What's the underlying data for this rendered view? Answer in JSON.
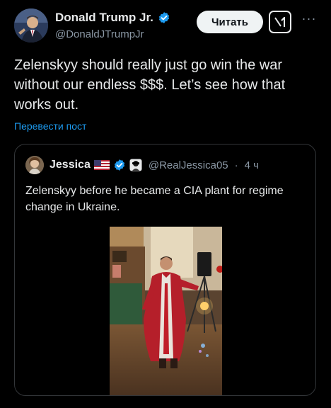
{
  "author": {
    "display_name": "Donald Trump Jr.",
    "handle": "@DonaldJTrumpJr",
    "follow_label": "Читать",
    "grok_icon": "grok-icon",
    "more_icon": "more-dots-icon",
    "more_label": "···"
  },
  "tweet": {
    "text": "Zelenskyy should really just go win the war without our endless $$$. Let’s see how that works out.",
    "translate_label": "Перевести пост"
  },
  "quote": {
    "display_name": "Jessica",
    "handle": "@RealJessica05",
    "separator": "·",
    "time": "4 ч",
    "text": "Zelenskyy before he became a CIA plant for regime change in Ukraine.",
    "media": "video-thumbnail"
  },
  "colors": {
    "background": "#000000",
    "text": "#e7e9ea",
    "secondary": "#8b98a5",
    "link": "#1d9bf0",
    "verified": "#1d9bf0",
    "border": "#333639",
    "button": "#eff3f4"
  }
}
